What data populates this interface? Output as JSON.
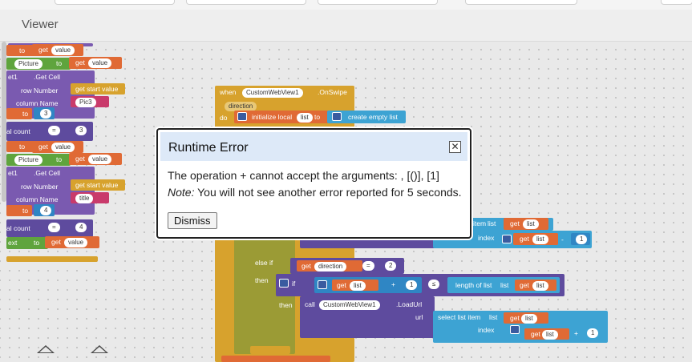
{
  "panel": {
    "title": "Viewer"
  },
  "dialog": {
    "title": "Runtime Error",
    "close_glyph": "✕",
    "message": "The operation + cannot accept the arguments: , [()], [1]",
    "note_label": "Note:",
    "note_text": " You will not see another error reported for 5 seconds.",
    "dismiss_label": "Dismiss"
  },
  "blocks_left": [
    {
      "kw1": "to",
      "kw2": "get",
      "val": "value"
    },
    {
      "chip": "Picture",
      "kw": "to",
      "kw2": "get",
      "val": "value"
    },
    {
      "prefix": "et1",
      "method": ".Get Cell"
    },
    {
      "kw": "row Number",
      "val": "get start value"
    },
    {
      "kw": "column Name",
      "val": "Pic3"
    },
    {
      "kw": "to",
      "val": "3"
    },
    {
      "prefix": "al count",
      "op": "=",
      "val": "3"
    },
    {
      "kw1": "to",
      "kw2": "get",
      "val": "value"
    },
    {
      "chip": "Picture",
      "kw": "to",
      "kw2": "get",
      "val": "value"
    },
    {
      "prefix": "et1",
      "method": ".Get Cell"
    },
    {
      "kw": "row Number",
      "val": "get start value"
    },
    {
      "kw": "column Name",
      "val": "title"
    },
    {
      "kw": "to",
      "val": "4"
    },
    {
      "prefix": "al count",
      "op": "=",
      "val": "4"
    },
    {
      "prefix": "ext",
      "kw": "to",
      "kw2": "get",
      "val": "value"
    }
  ],
  "event_block": {
    "when": "when",
    "component": "CustomWebView1",
    "event": ".OnSwipe",
    "param": "direction",
    "do": "do",
    "init": "initialize local",
    "var": "list",
    "to": "to",
    "create": "create empty list"
  },
  "lower_blocks": {
    "item": "item",
    "list": "list",
    "get": "get",
    "index": "index",
    "minus": "-",
    "one": "1",
    "elseif": "else if",
    "then": "then",
    "if": "if",
    "direction": "direction",
    "eq": "=",
    "two": "2",
    "plus": "+",
    "lte": "≤",
    "length_of_list": "length of list",
    "list_kw": "list",
    "call": "call",
    "component": "CustomWebView1",
    "load": ".LoadUrl",
    "url": "url",
    "select": "select list item",
    "select_list": "list"
  }
}
